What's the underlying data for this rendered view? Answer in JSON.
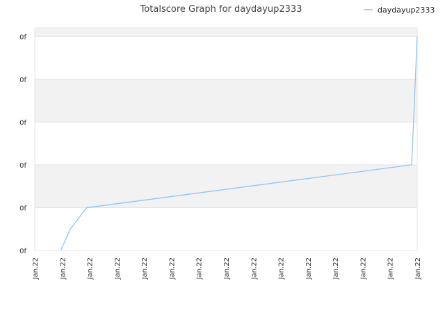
{
  "chart_data": {
    "type": "line",
    "title": "Totalscore Graph for daydayup2333",
    "xlabel": "",
    "ylabel": "",
    "x_tick_labels": [
      "Jan.22",
      "Jan.22",
      "Jan.22",
      "Jan.22",
      "Jan.22",
      "Jan.22",
      "Jan.22",
      "Jan.22",
      "Jan.22",
      "Jan.22",
      "Jan.22",
      "Jan.22",
      "Jan.22",
      "Jan.22",
      "Jan.22"
    ],
    "y_tick_labels": [
      "0f",
      "0f",
      "0f",
      "0f",
      "0f",
      "0f"
    ],
    "y_tick_values": [
      0,
      1,
      2,
      3,
      4,
      5
    ],
    "xlim": [
      0,
      14
    ],
    "ylim": [
      0,
      5.2
    ],
    "grid": true,
    "legend": "top-right",
    "series": [
      {
        "name": "daydayup2333",
        "color": "#90c4f0",
        "x": [
          0.95,
          1.3,
          1.9,
          13.8,
          14.0
        ],
        "values": [
          0,
          0.5,
          1,
          2,
          5
        ]
      }
    ]
  }
}
